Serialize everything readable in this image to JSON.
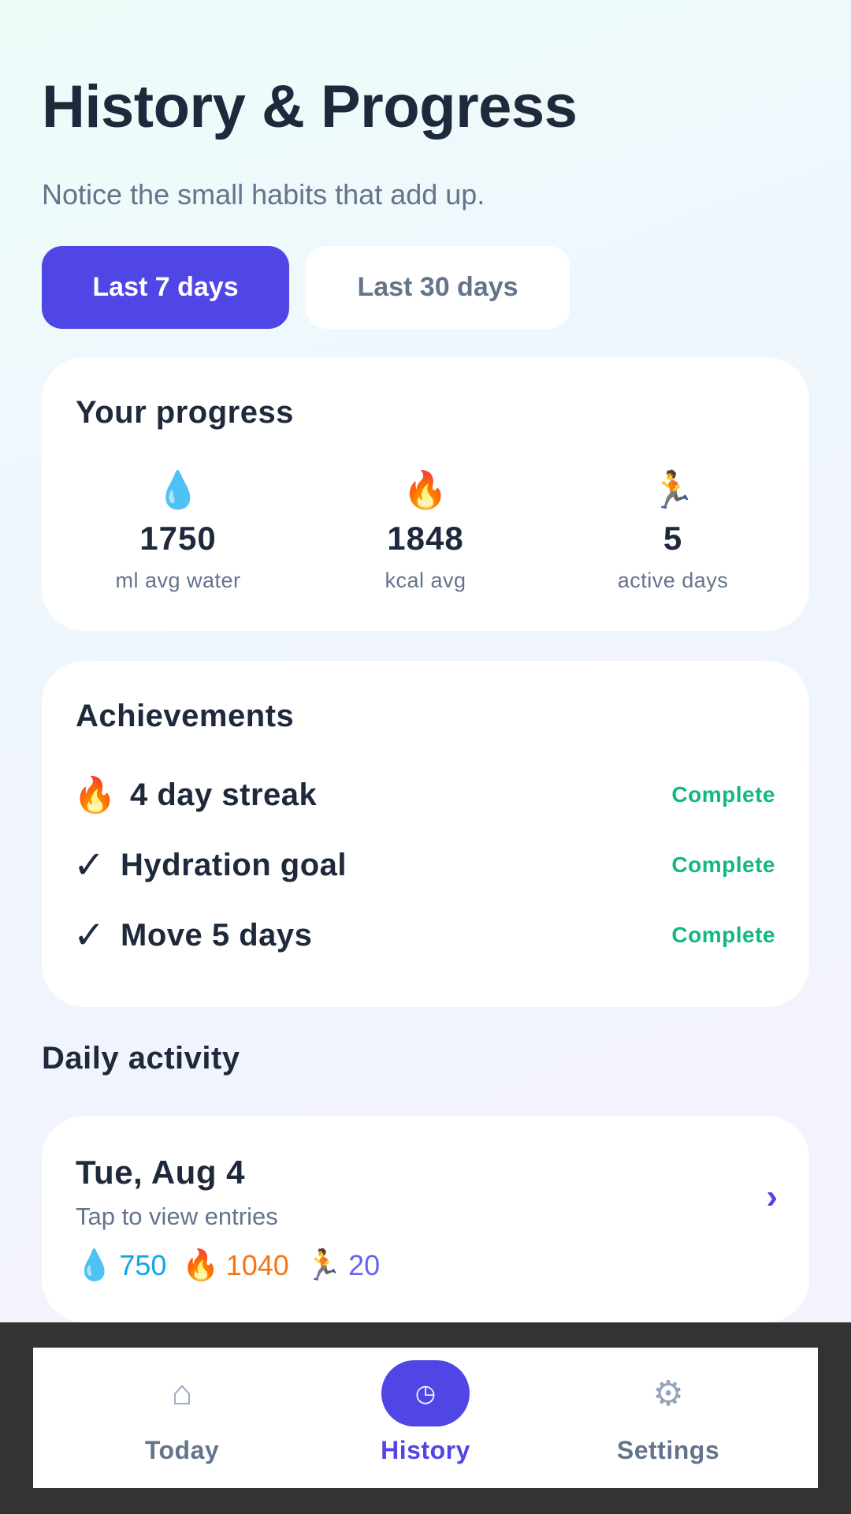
{
  "header": {
    "title": "History & Progress",
    "subtitle": "Notice the small habits that add up."
  },
  "range_tabs": {
    "active": "Last 7 days",
    "inactive": "Last 30 days"
  },
  "progress": {
    "title": "Your progress",
    "stats": [
      {
        "icon": "water-drop-icon",
        "glyph": "💧",
        "value": "1750",
        "label": "ml avg water"
      },
      {
        "icon": "fire-icon",
        "glyph": "🔥",
        "value": "1848",
        "label": "kcal avg"
      },
      {
        "icon": "runner-icon",
        "glyph": "🏃",
        "value": "5",
        "label": "active days"
      }
    ]
  },
  "achievements": {
    "title": "Achievements",
    "items": [
      {
        "icon": "fire-icon",
        "glyph": "🔥",
        "label": "4 day streak",
        "status": "Complete"
      },
      {
        "icon": "check-icon",
        "glyph": "✓",
        "label": "Hydration goal",
        "status": "Complete"
      },
      {
        "icon": "check-icon",
        "glyph": "✓",
        "label": "Move 5 days",
        "status": "Complete"
      }
    ]
  },
  "daily": {
    "section_title": "Daily activity",
    "entries": [
      {
        "date": "Tue, Aug 4",
        "hint": "Tap to view entries",
        "chevron": "›",
        "water": {
          "glyph": "💧",
          "value": "750"
        },
        "kcal": {
          "glyph": "🔥",
          "value": "1040"
        },
        "move": {
          "glyph": "🏃",
          "value": "20"
        }
      }
    ]
  },
  "nav": {
    "items": [
      {
        "icon": "home-icon",
        "glyph": "⌂",
        "label": "Today"
      },
      {
        "icon": "history-icon",
        "glyph": "◷",
        "label": "History"
      },
      {
        "icon": "gear-icon",
        "glyph": "⚙",
        "label": "Settings"
      }
    ]
  },
  "colors": {
    "accent": "#4f46e5",
    "success": "#10b981",
    "water": "#0ea5e9",
    "kcal": "#f97316",
    "move": "#6366f1"
  }
}
